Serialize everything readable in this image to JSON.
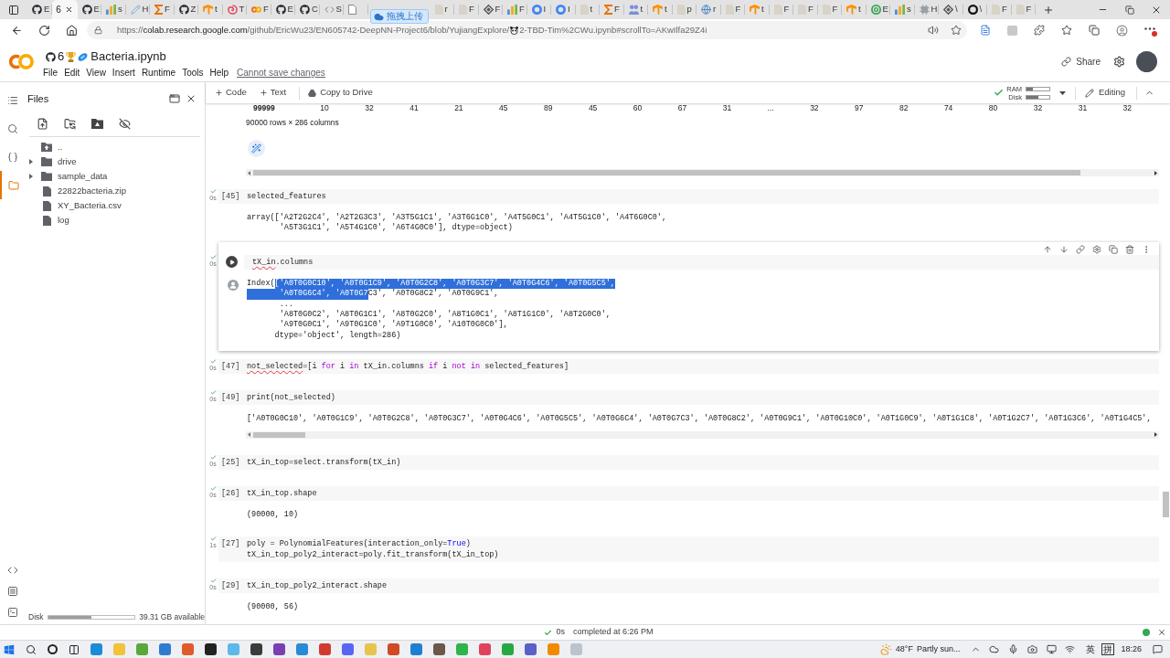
{
  "browser": {
    "tabs": [
      {
        "label": "E",
        "kind": "github",
        "selected": false
      },
      {
        "label": "6",
        "kind": "github",
        "selected": true
      },
      {
        "label": "E",
        "kind": "github",
        "selected": false
      },
      {
        "label": "s",
        "kind": "chart",
        "selected": false
      },
      {
        "label": "H",
        "kind": "pen",
        "selected": false
      },
      {
        "label": "F",
        "kind": "sigma",
        "selected": false
      },
      {
        "label": "Z",
        "kind": "github",
        "selected": false
      },
      {
        "label": "t",
        "kind": "tf",
        "selected": false
      },
      {
        "label": "T",
        "kind": "swirl",
        "selected": false
      },
      {
        "label": "F",
        "kind": "colab",
        "selected": false
      },
      {
        "label": "E",
        "kind": "github",
        "selected": false
      },
      {
        "label": "C",
        "kind": "github",
        "selected": false
      },
      {
        "label": "S",
        "kind": "code",
        "selected": false
      },
      {
        "kind": "doc",
        "selected": false
      },
      {
        "kind": "upload-widget",
        "label": "拖拽上传"
      },
      {
        "label": "r",
        "kind": "page",
        "selected": false
      },
      {
        "label": "F",
        "kind": "page",
        "selected": false
      },
      {
        "label": "F",
        "kind": "diamond",
        "selected": false
      },
      {
        "label": "F",
        "kind": "chart",
        "selected": false
      },
      {
        "label": "I",
        "kind": "google",
        "selected": false
      },
      {
        "label": "I",
        "kind": "google",
        "selected": false
      },
      {
        "label": "t",
        "kind": "page",
        "selected": false
      },
      {
        "label": "F",
        "kind": "sigma",
        "selected": false
      },
      {
        "label": "t",
        "kind": "people",
        "selected": false
      },
      {
        "label": "t",
        "kind": "tf",
        "selected": false
      },
      {
        "label": "p",
        "kind": "page",
        "selected": false
      },
      {
        "label": "r",
        "kind": "globe",
        "selected": false
      },
      {
        "label": "F",
        "kind": "page",
        "selected": false
      },
      {
        "label": "t",
        "kind": "tf",
        "selected": false
      },
      {
        "label": "F",
        "kind": "page",
        "selected": false
      },
      {
        "label": "F",
        "kind": "page",
        "selected": false
      },
      {
        "label": "F",
        "kind": "page",
        "selected": false
      },
      {
        "label": "t",
        "kind": "tf",
        "selected": false
      },
      {
        "label": "E",
        "kind": "spiral",
        "selected": false
      },
      {
        "label": "s",
        "kind": "chart",
        "selected": false
      },
      {
        "label": "H",
        "kind": "chip",
        "selected": false
      },
      {
        "label": "\\",
        "kind": "diamond",
        "selected": false
      },
      {
        "label": "\\",
        "kind": "ring",
        "selected": false
      },
      {
        "label": "F",
        "kind": "page",
        "selected": false
      },
      {
        "label": "F",
        "kind": "page",
        "selected": false
      }
    ],
    "address": {
      "scheme": "https://",
      "host": "colab.research.google.com",
      "path": "/github/EricWu23/EN605742-DeepNN-Project6/blob/YujiangExplore/",
      "path_end": "2-TBD-Tim%2CWu.ipynb#scrollTo=AKwIlfa29Z4i"
    }
  },
  "app": {
    "title_number": "6",
    "title": "Bacteria.ipynb",
    "menu": [
      "File",
      "Edit",
      "View",
      "Insert",
      "Runtime",
      "Tools",
      "Help"
    ],
    "save_notice": "Cannot save changes",
    "share": "Share"
  },
  "toolbar": {
    "add_code": "Code",
    "add_text": "Text",
    "copy_to_drive": "Copy to Drive",
    "resources": [
      {
        "label": "RAM",
        "level": 0.27
      },
      {
        "label": "Disk",
        "level": 0.52
      }
    ],
    "mode": "Editing"
  },
  "rail": [
    {
      "kind": "contents",
      "selected": false
    },
    {
      "kind": "search",
      "selected": false
    },
    {
      "kind": "variables",
      "selected": false
    },
    {
      "kind": "files",
      "selected": true
    }
  ],
  "rail_bottom": [
    {
      "kind": "snippets"
    },
    {
      "kind": "palette"
    },
    {
      "kind": "terminal"
    }
  ],
  "files": {
    "title": "Files",
    "tree": [
      {
        "name": "..",
        "kind": "parent"
      },
      {
        "name": "drive",
        "kind": "folder",
        "expanded": false
      },
      {
        "name": "sample_data",
        "kind": "folder",
        "expanded": false
      },
      {
        "name": "22822bacteria.zip",
        "kind": "file"
      },
      {
        "name": "XY_Bacteria.csv",
        "kind": "file"
      },
      {
        "name": "log",
        "kind": "file"
      }
    ],
    "disk": {
      "label": "Disk",
      "level": 0.5,
      "available": "39.31 GB available"
    }
  },
  "notebook": {
    "dataframe": {
      "index": "99999",
      "cells": [
        "10",
        "32",
        "41",
        "21",
        "45",
        "89",
        "45",
        "60",
        "67",
        "31",
        "...",
        "32",
        "97",
        "82",
        "74",
        "80",
        "32",
        "31",
        "32"
      ],
      "shape": "90000 rows × 286 columns"
    },
    "cells": [
      {
        "done": true,
        "time": "0s",
        "count": "[45]",
        "focused": false,
        "code": [
          [
            {
              "text": "selected_features",
              "kind": "plain"
            }
          ]
        ],
        "output": {
          "kind": "text",
          "lines": [
            "array(['A2T2G2C4', 'A2T2G3C3', 'A3T5G1C1', 'A3T6G1C0', 'A4T5G0C1', 'A4T5G1C0', 'A4T6G0C0',",
            "       'A5T3G1C1', 'A5T4G1C0', 'A6T4G0C0'], dtype=object)"
          ]
        }
      },
      {
        "done": true,
        "time": "0s",
        "focused": true,
        "code": [
          [
            {
              "text": "tX_in",
              "kind": "misspelled"
            },
            {
              "text": ".columns",
              "kind": "plain"
            }
          ]
        ],
        "output": {
          "kind": "text",
          "lines": [
            [
              {
                "text": "Index(",
                "selected": false
              },
              {
                "text": "['A0T0G0C10', 'A0T0G1C9', 'A0T0G2C8', 'A0T0G3C7', 'A0T0G4C6', 'A0T0G5C5',",
                "selected": true
              }
            ],
            [
              {
                "text": "       'A0T0G6C4', 'A0T0G7",
                "selected": true
              },
              {
                "text": "C3', 'A0T0G8C2', 'A0T0G9C1',",
                "selected": false
              }
            ],
            "       ...",
            "       'A8T0G0C2', 'A8T0G1C1', 'A8T0G2C0', 'A8T1G0C1', 'A8T1G1C0', 'A8T2G0C0',",
            "       'A9T0G0C1', 'A9T0G1C0', 'A9T1G0C0', 'A10T0G0C0'],",
            "      dtype='object', length=286)"
          ]
        }
      },
      {
        "done": true,
        "time": "0s",
        "count": "[47]",
        "focused": false,
        "code": [
          [
            {
              "text": "not_selected",
              "kind": "misspelled"
            },
            {
              "text": "=[i ",
              "kind": "plain"
            },
            {
              "text": "for",
              "kind": "keyword"
            },
            {
              "text": " i ",
              "kind": "plain"
            },
            {
              "text": "in",
              "kind": "keyword"
            },
            {
              "text": " tX_in.columns ",
              "kind": "plain"
            },
            {
              "text": "if",
              "kind": "keyword"
            },
            {
              "text": " i ",
              "kind": "plain"
            },
            {
              "text": "not in",
              "kind": "keyword"
            },
            {
              "text": " selected_features]",
              "kind": "plain"
            }
          ]
        ]
      },
      {
        "done": true,
        "time": "0s",
        "count": "[49]",
        "focused": false,
        "code": [
          [
            {
              "text": "print(not_selected)",
              "kind": "plain"
            }
          ]
        ],
        "output": {
          "kind": "scroll",
          "lines": [
            "['A0T0G0C10', 'A0T0G1C9', 'A0T0G2C8', 'A0T0G3C7', 'A0T0G4C6', 'A0T0G5C5', 'A0T0G6C4', 'A0T0G7C3', 'A0T0G8C2', 'A0T0G9C1', 'A0T0G10C0', 'A0T1G0C9', 'A0T1G1C8', 'A0T1G2C7', 'A0T1G3C6', 'A0T1G4C5',"
          ]
        }
      },
      {
        "done": true,
        "time": "0s",
        "count": "[25]",
        "focused": false,
        "code": [
          [
            {
              "text": "tX_in_top=select.transform(tX_in)",
              "kind": "plain"
            }
          ]
        ]
      },
      {
        "done": true,
        "time": "0s",
        "count": "[26]",
        "focused": false,
        "code": [
          [
            {
              "text": "tX_in_top.shape",
              "kind": "plain"
            }
          ]
        ],
        "output": {
          "kind": "text",
          "lines": [
            "(90000, 10)"
          ]
        }
      },
      {
        "done": true,
        "time": "1s",
        "count": "[27]",
        "focused": false,
        "code": [
          [
            {
              "text": "poly = PolynomialFeatures(interaction_only=",
              "kind": "plain"
            },
            {
              "text": "True",
              "kind": "constant"
            },
            {
              "text": ")",
              "kind": "plain"
            }
          ],
          [
            {
              "text": "tX_in_top_poly2_interact=poly.fit_transform(tX_in_top)",
              "kind": "plain"
            }
          ]
        ]
      },
      {
        "done": true,
        "time": "0s",
        "count": "[29]",
        "focused": false,
        "code": [
          [
            {
              "text": "tX_in_top_poly2_interact.shape",
              "kind": "plain"
            }
          ]
        ],
        "output": {
          "kind": "text",
          "lines": [
            "(90000, 56)"
          ]
        }
      }
    ]
  },
  "status": {
    "duration": "0s",
    "message": "completed at 6:26 PM",
    "connected": true
  },
  "taskbar": {
    "weather": {
      "temperature": "48°F",
      "summary": "Partly sun..."
    },
    "input_language": "英",
    "input_mode": "拼",
    "time": "18:26"
  }
}
